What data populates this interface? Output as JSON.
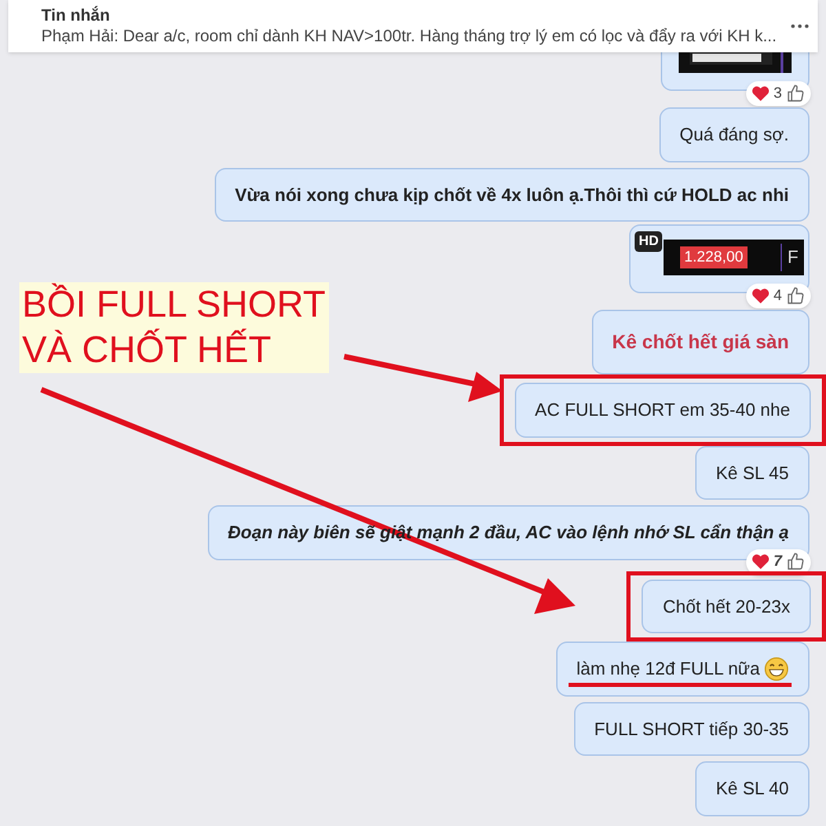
{
  "header": {
    "title": "Tin nhắn",
    "preview": "Phạm Hải: Dear a/c, room chỉ dành KH NAV>100tr. Hàng tháng trợ lý em có lọc và đẩy ra với KH k..."
  },
  "messages": [
    {
      "kind": "picture",
      "reaction_count": "3"
    },
    {
      "kind": "plain",
      "text": "Quá đáng sợ."
    },
    {
      "kind": "bold",
      "text": "Vừa nói xong chưa kịp chốt về 4x luôn ạ.Thôi thì cứ HOLD ac nhi"
    },
    {
      "kind": "chart",
      "badge": "HD",
      "price": "1.228,00",
      "edge_text": "F",
      "reaction_count": "4"
    },
    {
      "kind": "alert",
      "text": "Kê chốt hết giá sàn"
    },
    {
      "kind": "plain",
      "text": "AC FULL SHORT em 35-40 nhe",
      "boxed": true
    },
    {
      "kind": "plain",
      "text": "Kê SL 45"
    },
    {
      "kind": "emphasis",
      "text": "Đoạn này biên sẽ giật mạnh 2 đầu, AC vào lệnh nhớ SL cẩn thận ạ",
      "reaction_count": "7"
    },
    {
      "kind": "plain",
      "text": "Chốt hết 20-23x",
      "boxed": true
    },
    {
      "kind": "plain",
      "text": "làm nhẹ 12đ FULL nữa",
      "underlined": true,
      "emoji": true
    },
    {
      "kind": "plain",
      "text": "FULL SHORT tiếp 30-35"
    },
    {
      "kind": "plain",
      "text": "Kê SL 40"
    }
  ],
  "note": {
    "lines": [
      "BỒI FULL SHORT",
      "VÀ CHỐT HẾT"
    ]
  }
}
